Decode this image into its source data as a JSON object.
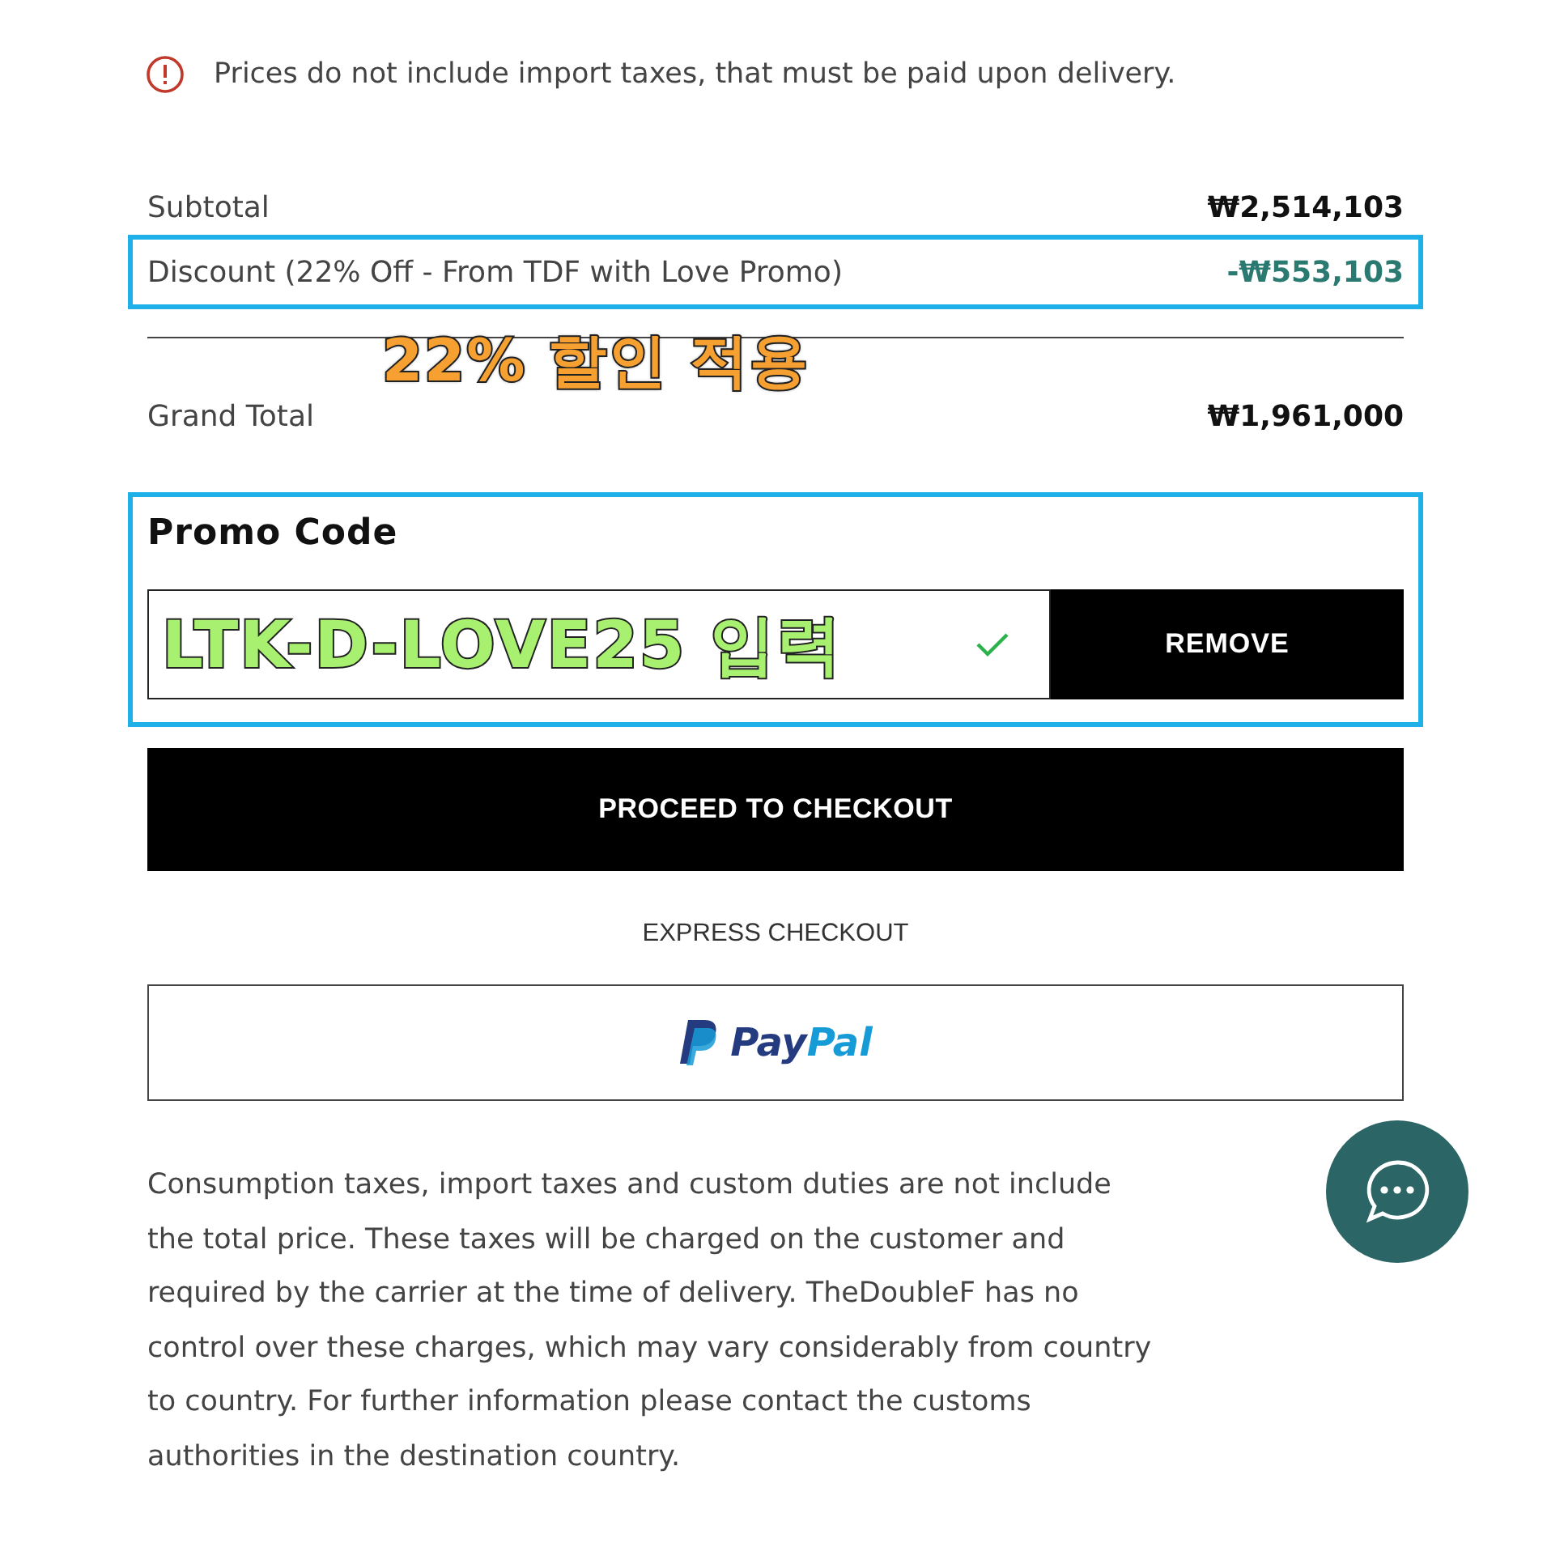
{
  "notice": "Prices do not include import taxes, that must be paid upon delivery.",
  "summary": [
    {
      "label": "Subtotal",
      "value": "₩2,514,103",
      "kind": "plain",
      "highlighted": false
    },
    {
      "label": "Discount (22% Off - From TDF with Love Promo)",
      "value": "-₩553,103",
      "kind": "discount",
      "highlighted": true
    }
  ],
  "grand_total": {
    "label": "Grand Total",
    "value": "₩1,961,000",
    "annotation": "22% 할인 적용"
  },
  "promo": {
    "title": "Promo Code",
    "highlighted": true,
    "annotation": "LTK-D-LOVE25 입력",
    "valid": true,
    "button": "REMOVE"
  },
  "checkout_button": "PROCEED TO CHECKOUT",
  "express": {
    "label": "EXPRESS CHECKOUT",
    "paypal_left": "Pay",
    "paypal_right": "Pal"
  },
  "disclaimer": "Consumption taxes, import taxes and custom duties are not include\nthe total price. These taxes will be charged on the customer and\nrequired by the carrier at the time of delivery. TheDoubleF has no\ncontrol over these charges, which may vary considerably from country\nto country. For further information please contact the customs\nauthorities in the destination country."
}
